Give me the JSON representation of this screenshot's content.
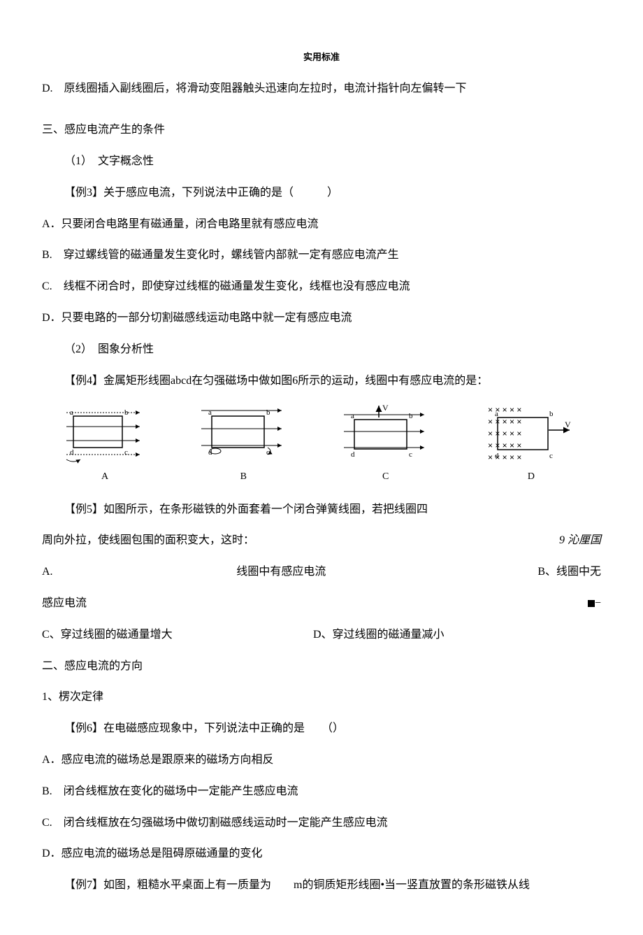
{
  "header": "实用标准",
  "dOption": "D.　原线圈插入副线圈后，将滑动变阻器触头迅速向左拉时，电流计指针向左偏转一下",
  "section3": {
    "title": "三、感应电流产生的条件",
    "sub1": "（1）　文字概念性",
    "ex3": {
      "title": "【例3】关于感应电流，下列说法中正确的是（　　　）",
      "a": "A．只要闭合电路里有磁通量，闭合电路里就有感应电流",
      "b": "B.　穿过螺线管的磁通量发生变化时，螺线管内部就一定有感应电流产生",
      "c": "C.　线框不闭合时，即使穿过线框的磁通量发生变化，线框也没有感应电流",
      "d": "D．只要电路的一部分切割磁感线运动电路中就一定有感应电流"
    },
    "sub2": "（2）　图象分析性",
    "ex4": "【例4】金属矩形线圈abcd在匀强磁场中做如图6所示的运动，线圈中有感应电流的是：",
    "diagLabels": {
      "a": "A",
      "b": "B",
      "c": "C",
      "d": "D"
    },
    "ex5": {
      "line1": "【例5】如图所示，在条形磁铁的外面套着一个闭合弹簧线圈，若把线圈四",
      "line2left": "周向外拉，使线圈包围的面积变大，这时：",
      "line2right": "9 沁厘国",
      "a": "A.",
      "aMid": "线圈中有感应电流",
      "bRight": "B、线圈中无",
      "abCont": "感应电流",
      "c": "C、穿过线圈的磁通量增大",
      "d": "D、穿过线圈的磁通量减小"
    }
  },
  "section2": {
    "title": "二、感应电流的方向",
    "sub1": "1、楞次定律",
    "ex6": {
      "title": "【例6】在电磁感应现象中，下列说法中正确的是　　（）",
      "a": "A．感应电流的磁场总是跟原来的磁场方向相反",
      "b": "B.　闭合线框放在变化的磁场中一定能产生感应电流",
      "c": "C.　闭合线框放在匀强磁场中做切割磁感线运动时一定能产生感应电流",
      "d": "D．感应电流的磁场总是阻碍原磁通量的变化"
    },
    "ex7": "【例7】如图，粗糙水平桌面上有一质量为　　m的铜质矩形线圈•当一竖直放置的条形磁铁从线"
  },
  "svgLabels": {
    "a": "a",
    "b": "b",
    "c": "c",
    "d": "d",
    "v": "V"
  }
}
